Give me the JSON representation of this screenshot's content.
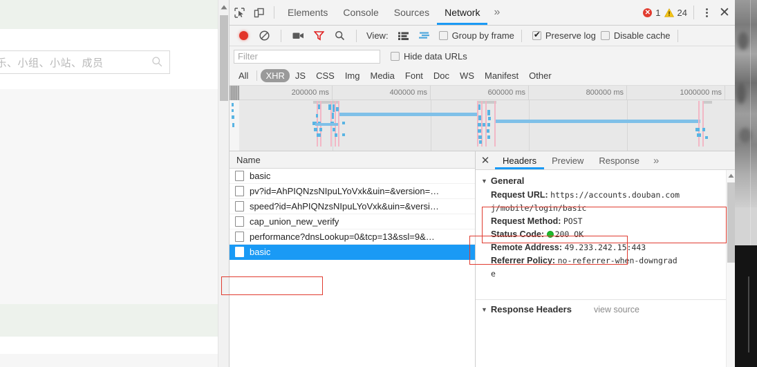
{
  "background_page": {
    "search_placeholder": "影、音乐、小组、小站、成员",
    "search_icon": "search-icon"
  },
  "devtools": {
    "main_tabs": [
      {
        "label": "Elements",
        "active": false
      },
      {
        "label": "Console",
        "active": false
      },
      {
        "label": "Sources",
        "active": false
      },
      {
        "label": "Network",
        "active": true
      }
    ],
    "more_tabs_glyph": "»",
    "icons": {
      "inspect": "inspect-element-icon",
      "device": "device-toolbar-icon",
      "record": "record-button-icon",
      "clear": "clear-icon",
      "camera": "capture-screenshots-icon",
      "filter": "filter-icon",
      "search": "search-icon",
      "list_view": "list-view-icon",
      "waterfall_view": "waterfall-view-icon",
      "kebab": "more-options-icon",
      "close": "close-devtools-icon"
    },
    "counters": {
      "errors": "1",
      "warnings": "24"
    },
    "network_toolbar": {
      "view_label": "View:",
      "checkboxes": [
        {
          "label": "Group by frame",
          "checked": false
        },
        {
          "label": "Preserve log",
          "checked": true
        },
        {
          "label": "Disable cache",
          "checked": false
        }
      ]
    },
    "filter_row": {
      "filter_placeholder": "Filter",
      "filter_value": "",
      "hide_data_urls": {
        "label": "Hide data URLs",
        "checked": false
      }
    },
    "type_filters": [
      {
        "label": "All",
        "active": false
      },
      {
        "label": "XHR",
        "active": true
      },
      {
        "label": "JS",
        "active": false
      },
      {
        "label": "CSS",
        "active": false
      },
      {
        "label": "Img",
        "active": false
      },
      {
        "label": "Media",
        "active": false
      },
      {
        "label": "Font",
        "active": false
      },
      {
        "label": "Doc",
        "active": false
      },
      {
        "label": "WS",
        "active": false
      },
      {
        "label": "Manifest",
        "active": false
      },
      {
        "label": "Other",
        "active": false
      }
    ],
    "overview": {
      "ticks": [
        "200000 ms",
        "400000 ms",
        "600000 ms",
        "800000 ms",
        "1000000 ms"
      ]
    },
    "request_list": {
      "column_header": "Name",
      "rows": [
        {
          "name": "basic",
          "selected": false
        },
        {
          "name": "pv?id=AhPIQNzsNIpuLYoVxk&uin=&version=…",
          "selected": false
        },
        {
          "name": "speed?id=AhPIQNzsNIpuLYoVxk&uin=&versi…",
          "selected": false
        },
        {
          "name": "cap_union_new_verify",
          "selected": false
        },
        {
          "name": "performance?dnsLookup=0&tcp=13&ssl=9&…",
          "selected": false
        },
        {
          "name": "basic",
          "selected": true
        }
      ]
    },
    "details": {
      "tabs": [
        {
          "label": "Headers",
          "active": true
        },
        {
          "label": "Preview",
          "active": false
        },
        {
          "label": "Response",
          "active": false
        }
      ],
      "more_glyph": "»",
      "close_glyph": "✕",
      "general": {
        "section_label": "General",
        "request_url_key": "Request URL:",
        "request_url_value_line1": "https://accounts.douban.com",
        "request_url_value_line2": "j/mobile/login/basic",
        "request_method_key": "Request Method:",
        "request_method_value": "POST",
        "status_code_key": "Status Code:",
        "status_code_value": "200  OK",
        "remote_address_key": "Remote Address:",
        "remote_address_value": "49.233.242.15:443",
        "referrer_policy_key": "Referrer Policy:",
        "referrer_policy_value_line1": "no-referrer-when-downgrad",
        "referrer_policy_value_line2": "e"
      },
      "response_headers": {
        "section_label": "Response Headers",
        "view_source_label": "view source"
      }
    }
  },
  "colors": {
    "accent_blue": "#1a9af5",
    "record_red": "#e2352a",
    "error_red": "#e13b2f",
    "warning_yellow": "#f5c518",
    "status_green": "#1fba2c",
    "annotation_red": "#e03b2f",
    "selection_blue": "#1a9af5"
  }
}
